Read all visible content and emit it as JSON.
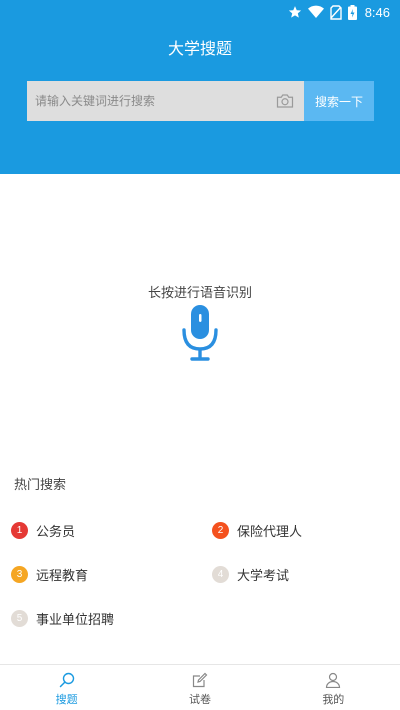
{
  "status": {
    "time": "8:46"
  },
  "app": {
    "title": "大学搜题"
  },
  "search": {
    "placeholder": "请输入关键词进行搜索",
    "button_label": "搜索一下"
  },
  "voice": {
    "hint": "长按进行语音识别"
  },
  "hot": {
    "title": "热门搜索",
    "items": [
      {
        "num": "1",
        "label": "公务员",
        "color": "#e53935"
      },
      {
        "num": "2",
        "label": "保险代理人",
        "color": "#f4511e"
      },
      {
        "num": "3",
        "label": "远程教育",
        "color": "#f5a623"
      },
      {
        "num": "4",
        "label": "大学考试",
        "color": "#e2dcd6"
      },
      {
        "num": "5",
        "label": "事业单位招聘",
        "color": "#e2dcd6"
      }
    ]
  },
  "tabs": [
    {
      "label": "搜题",
      "icon": "search-icon",
      "active": true
    },
    {
      "label": "试卷",
      "icon": "edit-icon",
      "active": false
    },
    {
      "label": "我的",
      "icon": "person-icon",
      "active": false
    }
  ],
  "colors": {
    "primary": "#1a9ae0",
    "button": "#5bb8f2"
  }
}
